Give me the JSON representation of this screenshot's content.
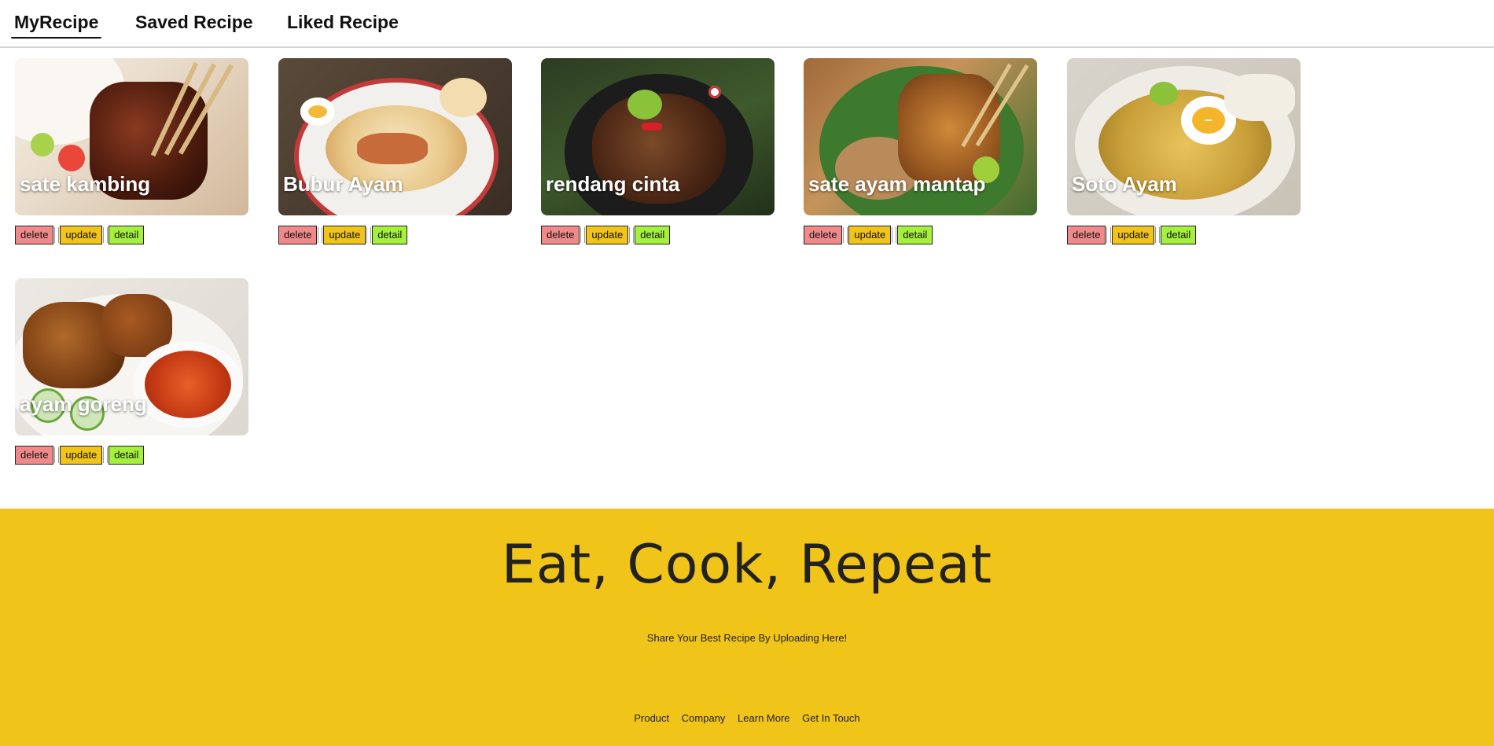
{
  "tabs": [
    {
      "label": "MyRecipe",
      "active": true
    },
    {
      "label": "Saved Recipe",
      "active": false
    },
    {
      "label": "Liked Recipe",
      "active": false
    }
  ],
  "actions": {
    "delete": "delete",
    "update": "update",
    "detail": "detail"
  },
  "recipes": [
    {
      "title": "sate kambing"
    },
    {
      "title": "Bubur Ayam"
    },
    {
      "title": "rendang cinta"
    },
    {
      "title": "sate ayam mantap"
    },
    {
      "title": "Soto Ayam"
    },
    {
      "title": "ayam goreng"
    }
  ],
  "footer": {
    "title": "Eat, Cook, Repeat",
    "subtitle": "Share Your Best Recipe By Uploading Here!",
    "links": [
      "Product",
      "Company",
      "Learn More",
      "Get In Touch"
    ]
  },
  "colors": {
    "accent": "#f0c419",
    "delete": "#f08a8a",
    "update": "#f0c419",
    "detail": "#a4f03c"
  }
}
